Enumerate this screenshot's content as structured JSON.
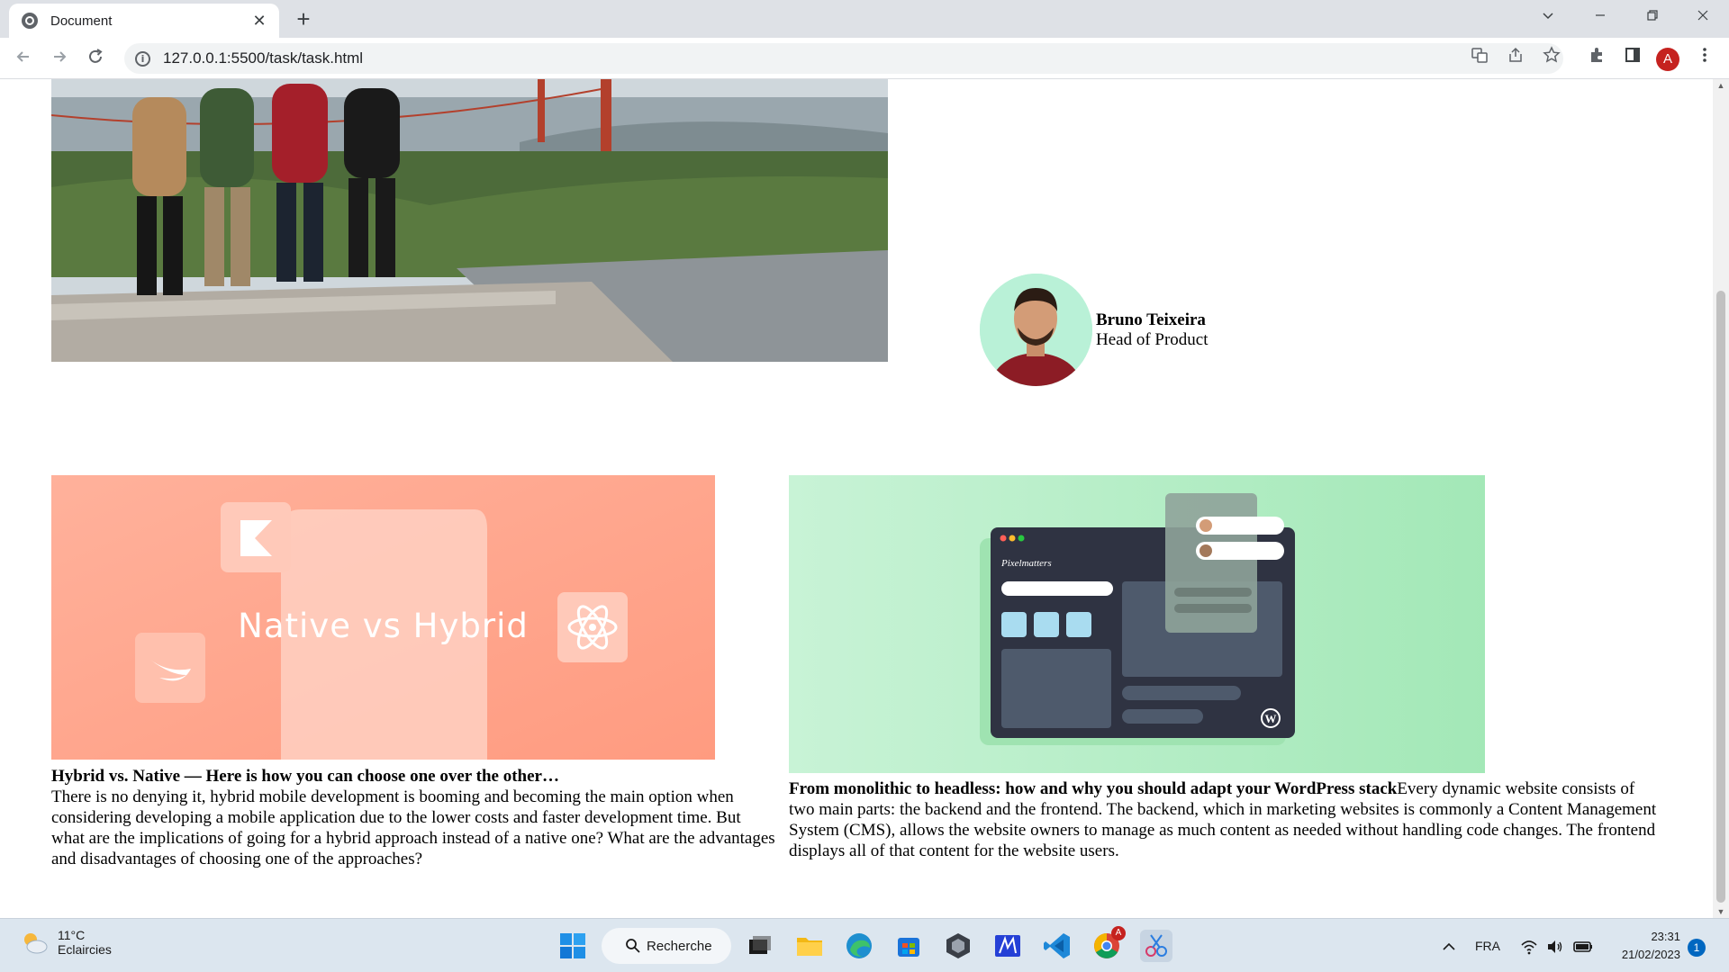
{
  "browser": {
    "tab_title": "Document",
    "tab_close": "✕",
    "new_tab": "+",
    "url": "127.0.0.1:5500/task/task.html",
    "profile_initial": "A"
  },
  "profile": {
    "name": "Bruno Teixeira",
    "role": "Head of Product"
  },
  "cards": [
    {
      "image_text": "Native vs Hybrid",
      "title": "Hybrid vs. Native — Here is how you can choose one over the other…",
      "body": "There is no denying it, hybrid mobile development is booming and becoming the main option when considering developing a mobile application due to the lower costs and faster development time. But what are the implications of going for a hybrid approach instead of a native one? What are the advantages and disadvantages of choosing one of the approaches?"
    },
    {
      "image_text": "Pixelmatters",
      "title": "From monolithic to headless: how and why you should adapt your WordPress stack",
      "body": "Every dynamic website consists of two main parts: the backend and the frontend. The backend, which in marketing websites is commonly a Content Management System (CMS), allows the website owners to manage as much content as needed without handling code changes. The frontend displays all of that content for the website users."
    }
  ],
  "taskbar": {
    "temperature": "11°C",
    "weather": "Eclaircies",
    "search_label": "Recherche",
    "language": "FRA",
    "time": "23:31",
    "date": "21/02/2023",
    "notification_count": "1",
    "chrome_badge": "A"
  },
  "icons": [
    "globe-icon",
    "close-icon",
    "plus-icon",
    "chevron-down-icon",
    "minimize-icon",
    "maximize-icon",
    "back-icon",
    "forward-icon",
    "reload-icon",
    "info-icon",
    "translate-icon",
    "share-icon",
    "star-icon",
    "extensions-icon",
    "sidepanel-icon",
    "menu-icon",
    "weather-icon",
    "windows-start-icon",
    "search-icon",
    "file-explorer-icon",
    "edge-icon",
    "store-icon",
    "vscode-icon",
    "chrome-icon"
  ]
}
